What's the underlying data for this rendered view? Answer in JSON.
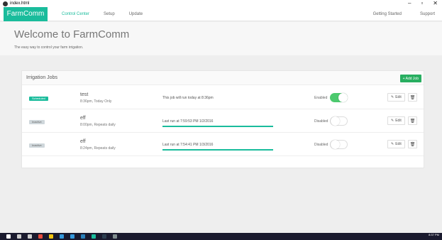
{
  "window": {
    "title": "index.html",
    "controls": [
      "–",
      "▫",
      "✕"
    ]
  },
  "nav": {
    "brand": "FarmComm",
    "links": [
      "Control Center",
      "Setup",
      "Update"
    ],
    "right_links": [
      "Getting Started",
      "Support"
    ],
    "active_link": "Control Center"
  },
  "hero": {
    "title": "Welcome to FarmComm",
    "subtitle": "The easy way to control your farm irrigation."
  },
  "panel": {
    "title": "Irrigation Jobs",
    "add_label": "+ Add Job",
    "edit_label": "Edit",
    "jobs": [
      {
        "status": "Scheduled",
        "name": "test",
        "schedule": "8:36pm, Today Only",
        "message": "This job will run today at 8:36pm",
        "progress": 0,
        "toggle_label": "Enabled",
        "enabled": true
      },
      {
        "status": "Inactive",
        "name": "eff",
        "schedule": "8:00pm, Repeats daily",
        "message": "Last run at 7:59:53 PM 1/2/2016",
        "progress": 1,
        "toggle_label": "Disabled",
        "enabled": false
      },
      {
        "status": "Inactive",
        "name": "eff",
        "schedule": "8:24pm, Repeats daily",
        "message": "Last run at 7:54:41 PM 1/3/2016",
        "progress": 1,
        "toggle_label": "Disabled",
        "enabled": false
      }
    ]
  },
  "taskbar": {
    "time": "8:37 PM",
    "icons": [
      "windows-icon",
      "search-icon",
      "task-view-icon",
      "chrome-icon",
      "folder-icon",
      "store-icon",
      "app-icon",
      "app-icon",
      "app-icon",
      "app-icon",
      "app-icon"
    ],
    "colors": [
      "#ffffff",
      "#cccccc",
      "#cccccc",
      "#e74c3c",
      "#f1c40f",
      "#3498db",
      "#3498db",
      "#2980b9",
      "#1abc9c",
      "#2c3e50",
      "#7f8c8d"
    ]
  },
  "colors": {
    "accent": "#1abc9c",
    "add_button": "#27ae60",
    "toggle_on": "#4cc96e"
  }
}
